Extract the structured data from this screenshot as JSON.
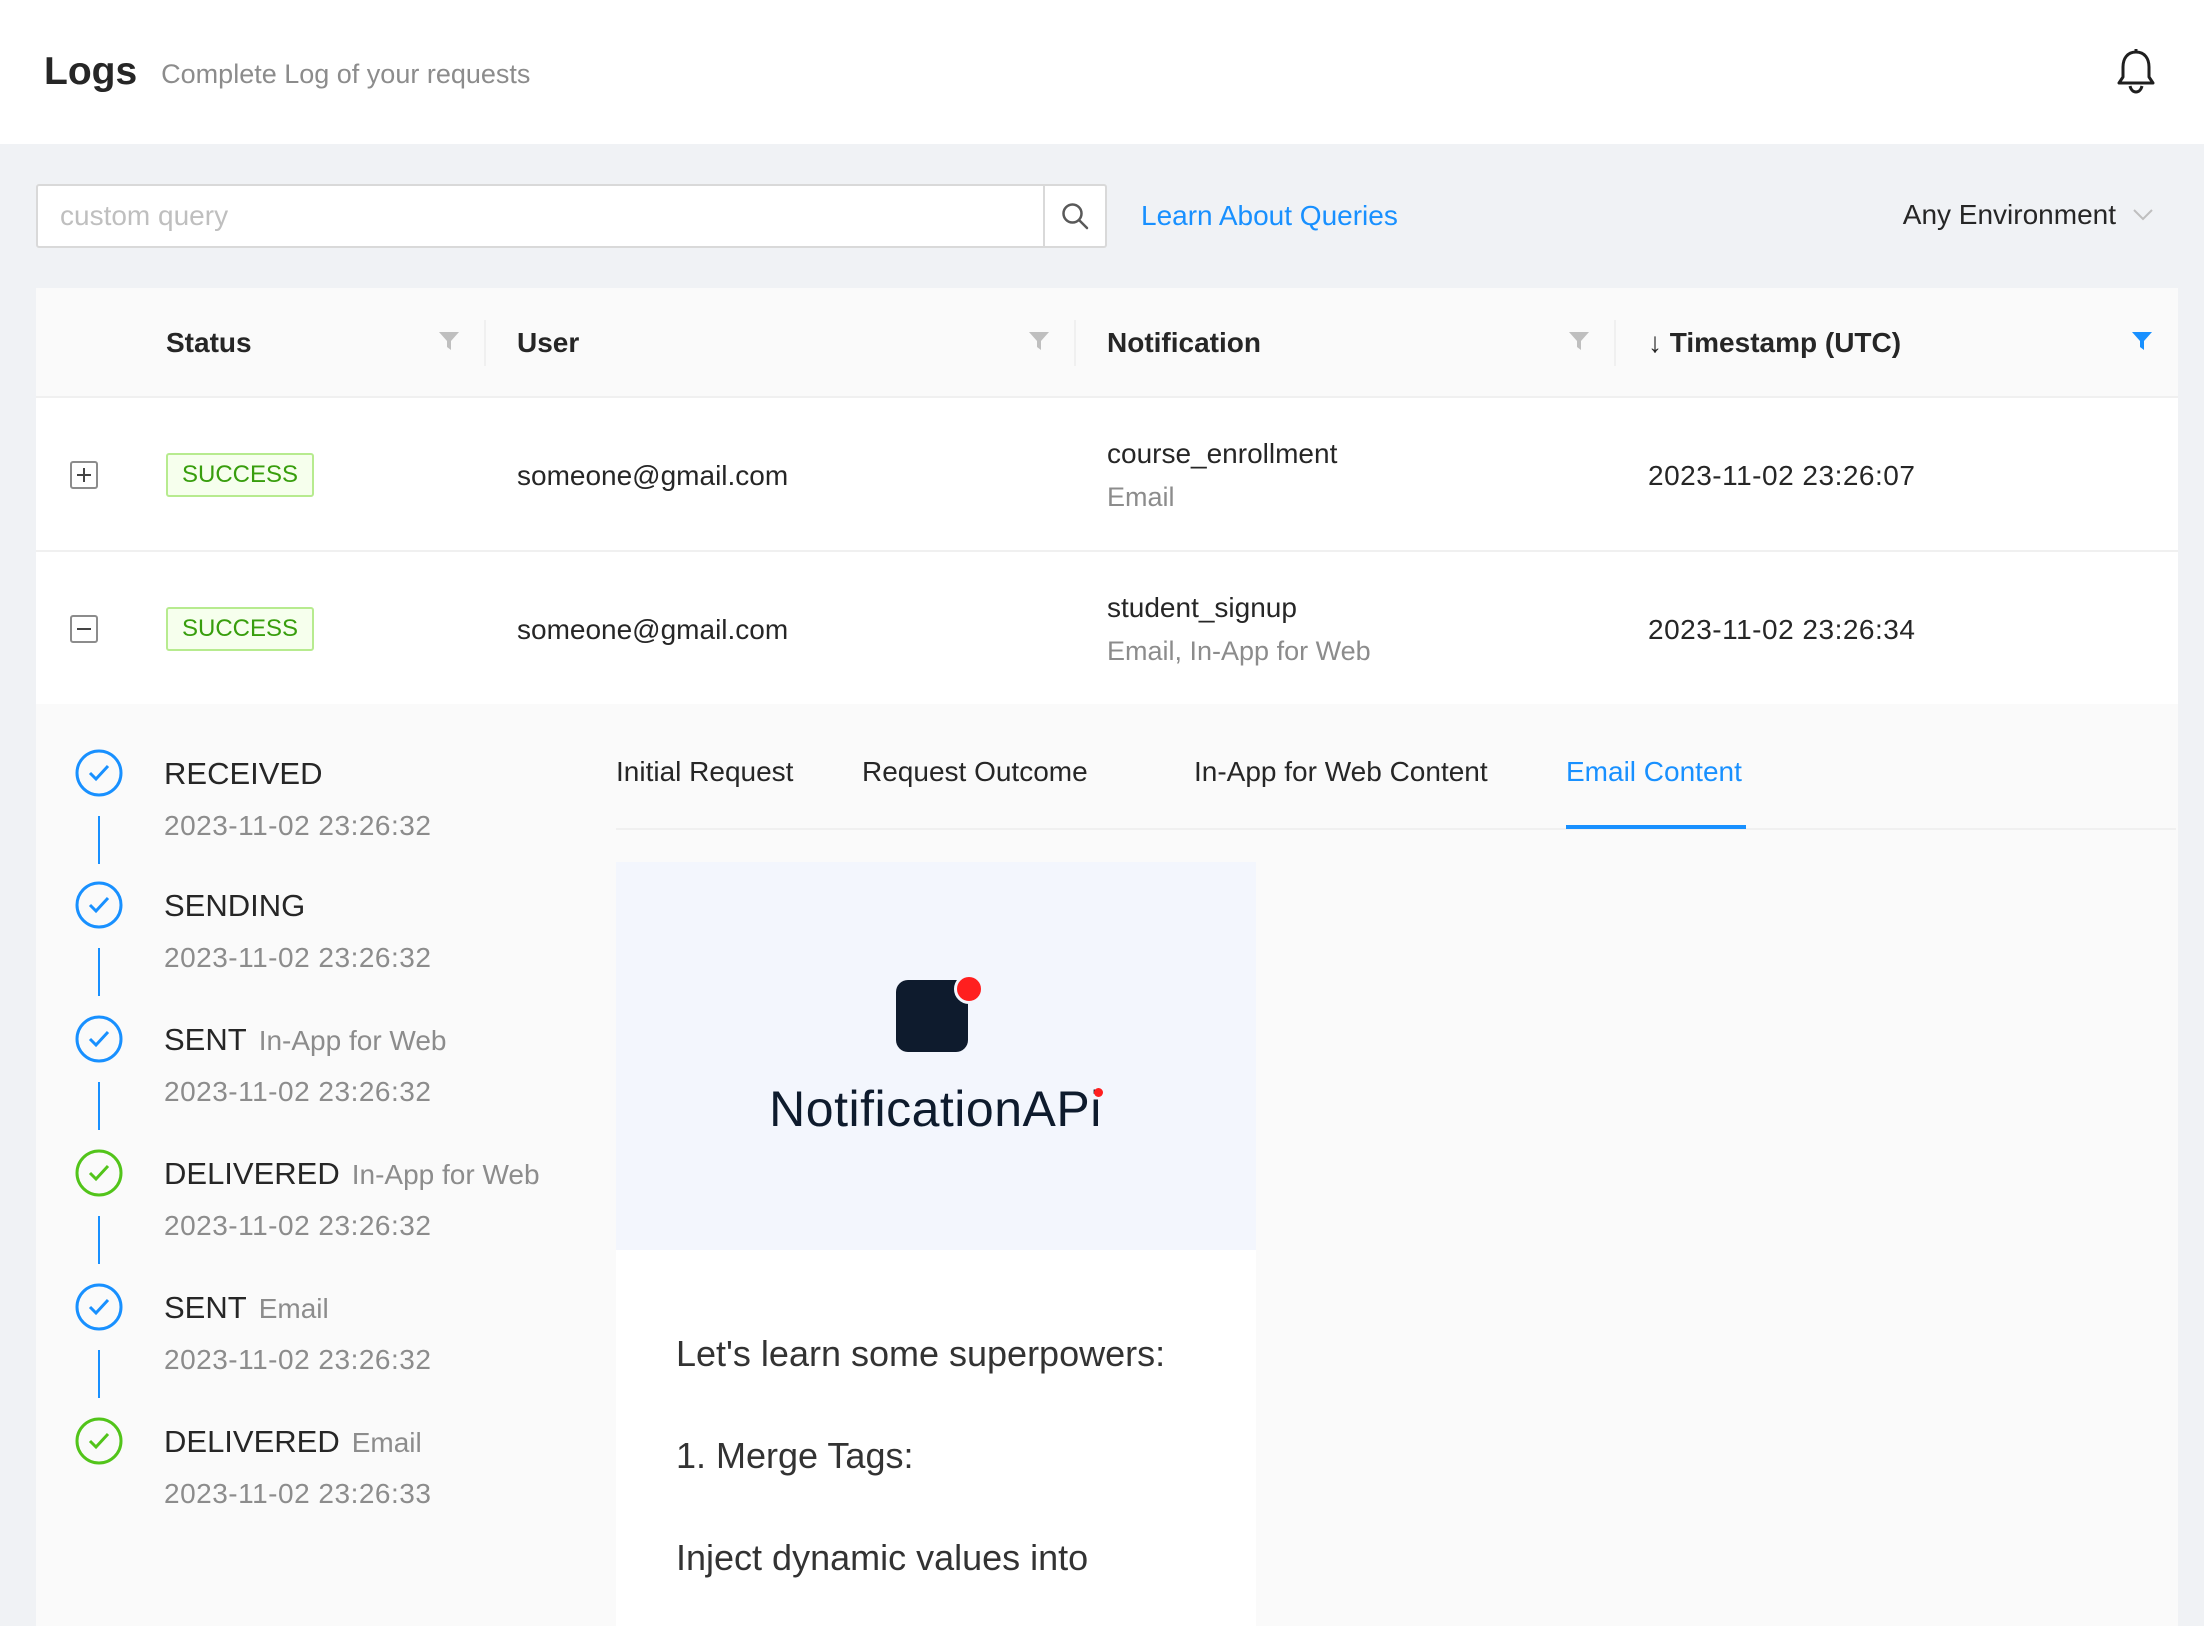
{
  "header": {
    "title": "Logs",
    "subtitle": "Complete Log of your requests"
  },
  "toolbar": {
    "search_placeholder": "custom query",
    "learn_link": "Learn About Queries",
    "environment": "Any Environment"
  },
  "table": {
    "columns": {
      "status": "Status",
      "user": "User",
      "notification": "Notification",
      "timestamp": "↓ Timestamp (UTC)"
    },
    "rows": [
      {
        "status": "SUCCESS",
        "user": "someone@gmail.com",
        "notification": "course_enrollment",
        "channels": "Email",
        "timestamp": "2023-11-02 23:26:07",
        "expanded": false
      },
      {
        "status": "SUCCESS",
        "user": "someone@gmail.com",
        "notification": "student_signup",
        "channels": "Email, In-App for Web",
        "timestamp": "2023-11-02 23:26:34",
        "expanded": true
      }
    ]
  },
  "timeline": [
    {
      "event": "RECEIVED",
      "channel": "",
      "time": "2023-11-02 23:26:32",
      "color": "#1890ff"
    },
    {
      "event": "SENDING",
      "channel": "",
      "time": "2023-11-02 23:26:32",
      "color": "#1890ff"
    },
    {
      "event": "SENT",
      "channel": "In-App for Web",
      "time": "2023-11-02 23:26:32",
      "color": "#1890ff"
    },
    {
      "event": "DELIVERED",
      "channel": "In-App for Web",
      "time": "2023-11-02 23:26:32",
      "color": "#52c41a"
    },
    {
      "event": "SENT",
      "channel": "Email",
      "time": "2023-11-02 23:26:32",
      "color": "#1890ff"
    },
    {
      "event": "DELIVERED",
      "channel": "Email",
      "time": "2023-11-02 23:26:33",
      "color": "#52c41a"
    }
  ],
  "tabs": [
    {
      "label": "Initial Request",
      "active": false
    },
    {
      "label": "Request Outcome",
      "active": false
    },
    {
      "label": "In-App for Web Content",
      "active": false
    },
    {
      "label": "Email Content",
      "active": true
    }
  ],
  "email": {
    "brand": "NotificationAPi",
    "body": [
      "Let's learn some superpowers:",
      "1. Merge Tags:",
      "Inject dynamic values into"
    ]
  },
  "colors": {
    "accent": "#1890ff",
    "success": "#52c41a",
    "brand_dark": "#0e1b2d",
    "brand_red": "#ff1f1f"
  }
}
